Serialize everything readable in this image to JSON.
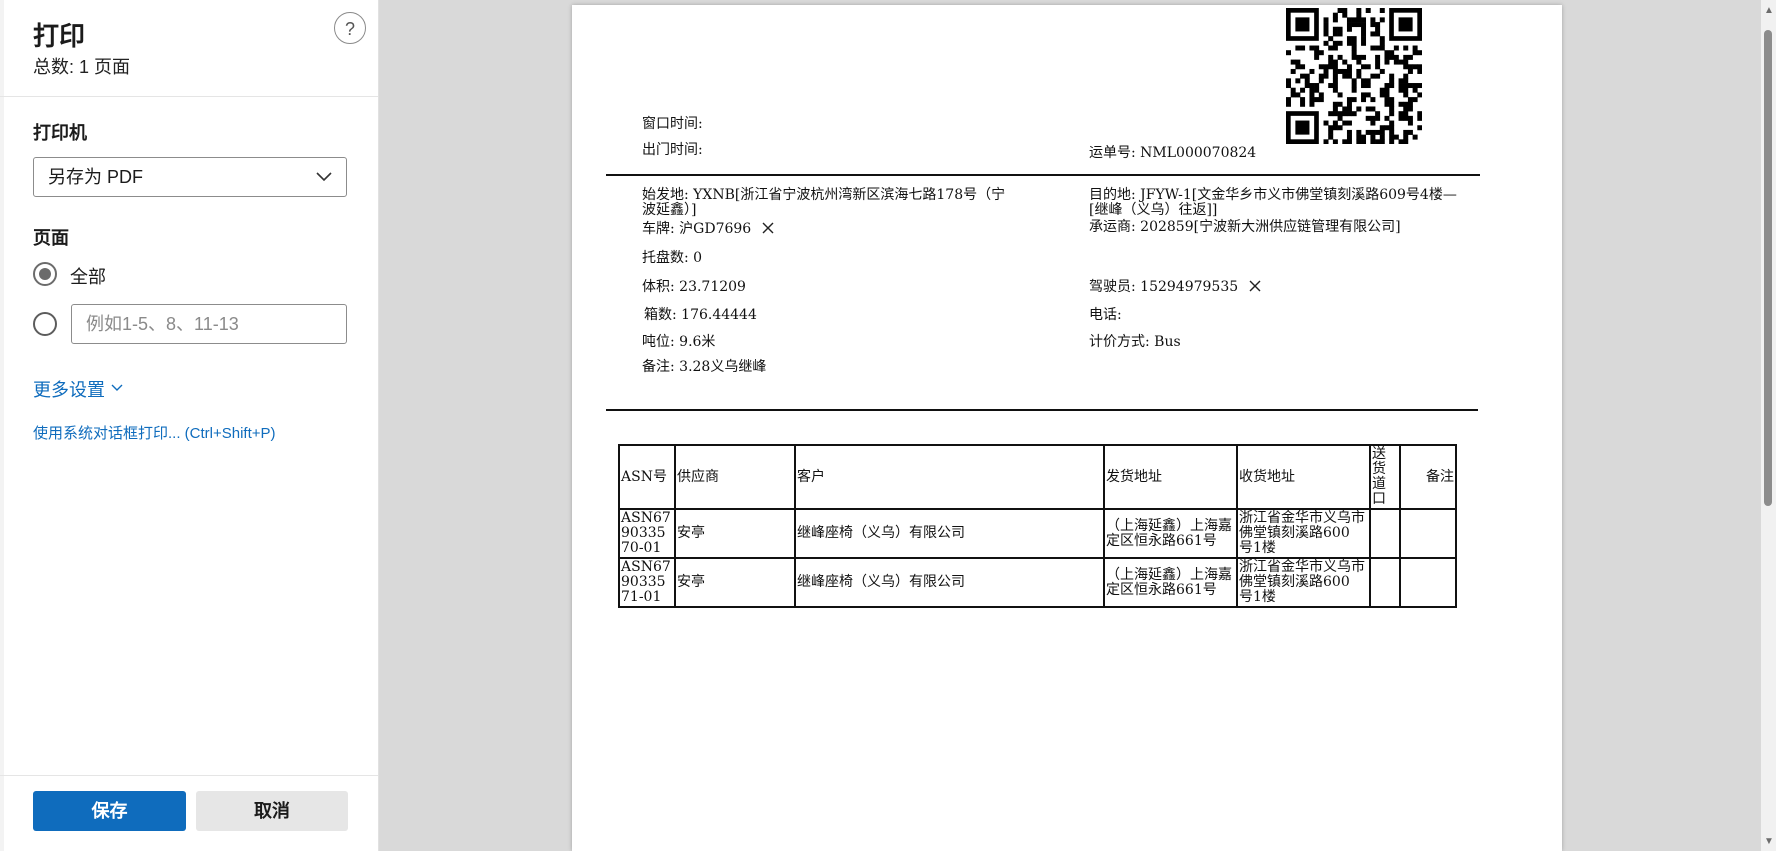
{
  "panel": {
    "title": "打印",
    "count": "总数: 1 页面",
    "help": "?",
    "printer_label": "打印机",
    "printer_value": "另存为 PDF",
    "pages_label": "页面",
    "all_label": "全部",
    "range_placeholder": "例如1-5、8、11-13",
    "more_settings": "更多设置",
    "system_dialog": "使用系统对话框打印... (Ctrl+Shift+P)",
    "save": "保存",
    "cancel": "取消"
  },
  "doc": {
    "window_time": "窗口时间:",
    "gate_time": "出门时间:",
    "waybill": "运单号: NML000070824",
    "origin_line1": "始发地: YXNB[浙江省宁波杭州湾新区滨海七路178号（宁",
    "origin_line2": "波延鑫）]",
    "dest_line1": "目的地: JFYW-1[文金华乡市义市佛堂镇刻溪路609号4楼—",
    "dest_line2": "[继峰（义乌）往返]]",
    "plate": "车牌: 沪GD7696",
    "carrier": "承运商: 202859[宁波新大洲供应链管理有限公司]",
    "pallets": "托盘数: 0",
    "volume": "体积: 23.71209",
    "driver": "驾驶员: 15294979535",
    "boxes": "箱数: 176.44444",
    "phone": "电话:",
    "tonnage": "吨位: 9.6米",
    "pricing": "计价方式: Bus",
    "remark": "备注: 3.28义乌继峰",
    "table": {
      "headers": [
        "ASN号",
        "供应商",
        "客户",
        "发货地址",
        "收货地址",
        "送货道口",
        "备注"
      ],
      "rows": [
        [
          "ASN679033570-01",
          "安亭",
          "继峰座椅（义乌）有限公司",
          "（上海延鑫）上海嘉定区恒永路661号",
          "浙江省金华市义乌市佛堂镇刻溪路600 号1楼",
          "",
          ""
        ],
        [
          "ASN679033571-01",
          "安亭",
          "继峰座椅（义乌）有限公司",
          "（上海延鑫）上海嘉定区恒永路661号",
          "浙江省金华市义乌市佛堂镇刻溪路600 号1楼",
          "",
          ""
        ]
      ]
    }
  },
  "icons": {
    "dropdown": "chevron-down-icon",
    "help": "question-icon",
    "qr": "qr-code-icon"
  },
  "colors": {
    "accent": "#0f6cbd",
    "backdrop": "#d9d9d9"
  }
}
